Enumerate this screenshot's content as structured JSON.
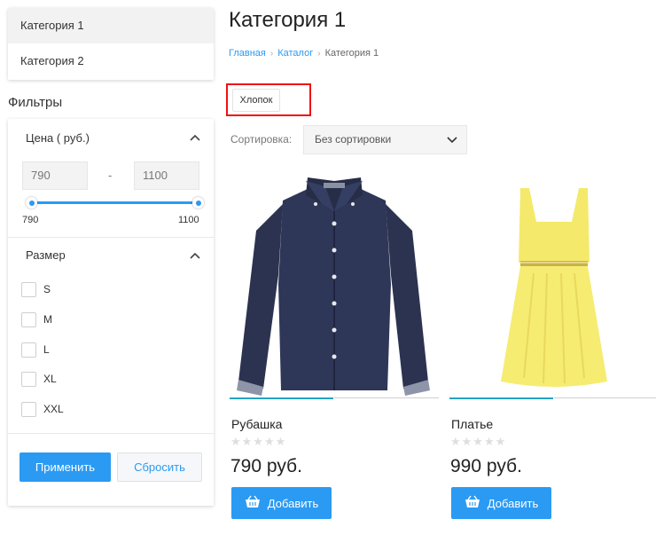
{
  "categories": [
    {
      "label": "Категория 1",
      "active": true
    },
    {
      "label": "Категория 2",
      "active": false
    }
  ],
  "filters": {
    "title": "Фильтры",
    "price": {
      "heading": "Цена ( руб.)",
      "min_value": "790",
      "max_value": "1100",
      "separator": "-",
      "range_min_label": "790",
      "range_max_label": "1100"
    },
    "size": {
      "heading": "Размер",
      "options": [
        "S",
        "M",
        "L",
        "XL",
        "XXL"
      ]
    },
    "apply_label": "Применить",
    "reset_label": "Сбросить"
  },
  "page": {
    "title": "Категория 1",
    "breadcrumb": [
      "Главная",
      "Каталог",
      "Категория 1"
    ],
    "active_tag": "Хлопок",
    "sort_label": "Сортировка:",
    "sort_value": "Без сортировки"
  },
  "products": [
    {
      "name": "Рубашка",
      "price": "790 руб.",
      "rating": 0,
      "add_label": "Добавить"
    },
    {
      "name": "Платье",
      "price": "990 руб.",
      "rating": 0,
      "add_label": "Добавить"
    }
  ],
  "colors": {
    "accent": "#2b9af3",
    "highlight": "#ee1111"
  }
}
